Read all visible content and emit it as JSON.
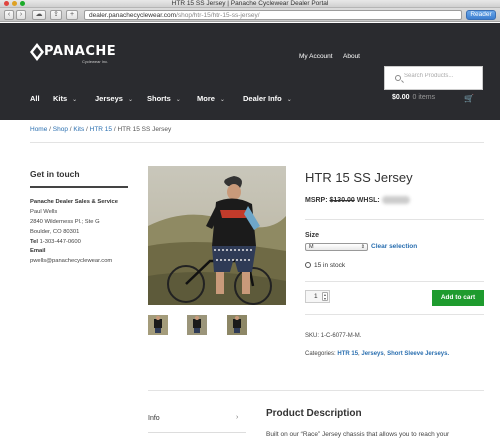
{
  "browser": {
    "window_title": "HTR 15 SS Jersey | Panache Cyclewear Dealer Portal",
    "url_host": "dealer.panachecyclewear.com",
    "url_path": "/shop/htr-15/htr-15-ss-jersey/",
    "reader_label": "Reader"
  },
  "header": {
    "logo_word": "PANACHE",
    "logo_sub": "Cyclewear Inc.",
    "my_account": "My Account",
    "about": "About",
    "search_placeholder": "Search Products...",
    "nav": [
      "All",
      "Kits",
      "Jerseys",
      "Shorts",
      "More",
      "Dealer Info"
    ],
    "cart_total": "$0.00",
    "cart_items": "0 items"
  },
  "breadcrumb": {
    "home": "Home",
    "shop": "Shop",
    "kits": "Kits",
    "htr15": "HTR 15",
    "current": "HTR 15 SS Jersey",
    "sep": " / "
  },
  "sidebar": {
    "title": "Get in touch",
    "company": "Panache Dealer Sales & Service",
    "person": "Paul Wells",
    "street": "2840 Wilderness Pl.; Ste G",
    "city": "Boulder, CO 80301",
    "tel_label": "Tel",
    "tel": "1-303-447-0600",
    "email_label": "Email",
    "email": "pwells@panachecyclewear.com"
  },
  "product": {
    "title": "HTR 15 SS Jersey",
    "msrp_label": "MSRP:",
    "msrp": "$130.00",
    "whsl_label": "WHSL:",
    "size_label": "Size",
    "size_value": "M",
    "clear_selection": "Clear selection",
    "stock": "15 in stock",
    "quantity": "1",
    "add_to_cart": "Add to cart",
    "sku_label": "SKU:",
    "sku": "1-C-6077-M-M.",
    "categories_label": "Categories:",
    "categories": [
      "HTR 15",
      "Jerseys",
      "Short Sleeve Jerseys."
    ]
  },
  "tabs": {
    "info": "Info"
  },
  "description": {
    "title": "Product Description",
    "text": "Built on our “Race” Jersey chassis that allows you to reach your"
  },
  "colors": {
    "header_bg": "#2a2b2f",
    "link": "#2a6fb0",
    "add_to_cart": "#1e9b2e"
  }
}
